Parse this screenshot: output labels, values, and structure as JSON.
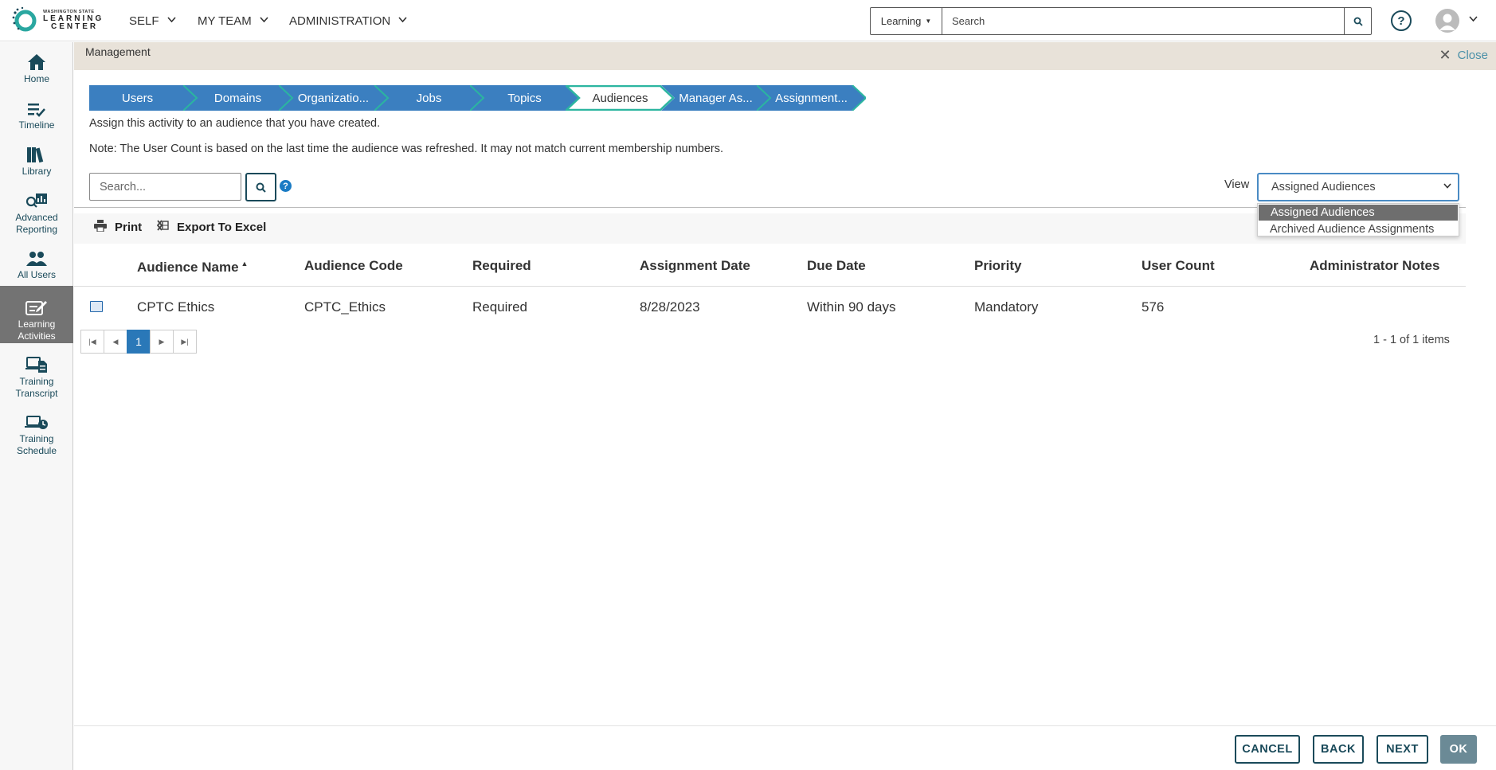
{
  "header": {
    "logo_small": "WASHINGTON STATE",
    "logo_line1": "LEARNING",
    "logo_line2": "CENTER",
    "nav": [
      "SELF",
      "MY TEAM",
      "ADMINISTRATION"
    ],
    "search_scope": "Learning",
    "search_placeholder": "Search",
    "help": "?"
  },
  "sidebar": {
    "items": [
      {
        "label": "Home",
        "icon": "home-icon"
      },
      {
        "label": "Timeline",
        "icon": "timeline-icon"
      },
      {
        "label": "Library",
        "icon": "library-icon"
      },
      {
        "label": "Advanced Reporting",
        "icon": "reporting-icon"
      },
      {
        "label": "All Users",
        "icon": "users-icon"
      },
      {
        "label": "Learning Activities",
        "icon": "learning-activities-icon",
        "active": true
      },
      {
        "label": "Training Transcript",
        "icon": "transcript-icon"
      },
      {
        "label": "Training Schedule",
        "icon": "schedule-icon"
      }
    ]
  },
  "management": {
    "title": "Management",
    "close_label": "Close"
  },
  "wizard": {
    "steps": [
      "Users",
      "Domains",
      "Organizatio...",
      "Jobs",
      "Topics",
      "Audiences",
      "Manager As...",
      "Assignment..."
    ],
    "active_index": 5,
    "colors": {
      "step": "#3b7fc0",
      "active": "#ffffff",
      "accent": "#2bb5a0"
    }
  },
  "content": {
    "intro": "Assign this activity to an audience that you have created.",
    "note": "Note: The User Count is based on the last time the audience was refreshed. It may not match current membership numbers.",
    "search_placeholder": "Search...",
    "help_glyph": "?",
    "view_label": "View",
    "view_selected": "Assigned Audiences",
    "view_options": [
      "Assigned Audiences",
      "Archived Audience Assignments"
    ]
  },
  "toolbar": {
    "print_label": "Print",
    "export_label": "Export To Excel"
  },
  "table": {
    "columns": [
      "Audience Name",
      "Audience Code",
      "Required",
      "Assignment Date",
      "Due Date",
      "Priority",
      "User Count",
      "Administrator Notes"
    ],
    "sorted_column": 0,
    "rows": [
      [
        "CPTC Ethics",
        "CPTC_Ethics",
        "Required",
        "8/28/2023",
        "Within 90 days",
        "Mandatory",
        "576",
        ""
      ]
    ]
  },
  "pager": {
    "current_page": "1",
    "info": "1 - 1 of 1 items"
  },
  "footer": {
    "cancel": "CANCEL",
    "back": "BACK",
    "next": "NEXT",
    "ok": "OK"
  }
}
